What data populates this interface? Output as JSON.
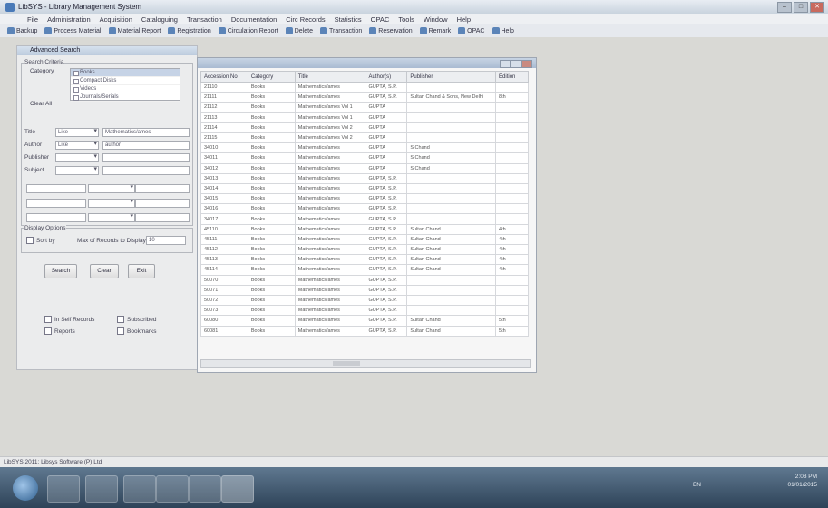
{
  "window": {
    "title": "LibSYS - Library Management System"
  },
  "menu": [
    "File",
    "Administration",
    "Acquisition",
    "Cataloguing",
    "Transaction",
    "Documentation",
    "Circ Records",
    "Statistics",
    "OPAC",
    "Tools",
    "Window",
    "Help"
  ],
  "toolbar": [
    "Backup",
    "Process Material",
    "Material Report",
    "Registration",
    "Circulation Report",
    "Delete",
    "Transaction",
    "Reservation",
    "Remark",
    "OPAC",
    "Help"
  ],
  "search": {
    "panel_title": "Advanced Search",
    "group_label": "Search Criteria",
    "category_label": "Category",
    "categories": [
      "Books",
      "Compact Disks",
      "Videos",
      "Journals/Serials"
    ],
    "clear_all_label": "Clear All",
    "rows": [
      {
        "label": "Title",
        "op": "Like",
        "value": "Mathematics/ames"
      },
      {
        "label": "Author",
        "op": "Like",
        "value": "author"
      },
      {
        "label": "Publisher",
        "op": "",
        "value": ""
      },
      {
        "label": "Subject",
        "op": "",
        "value": ""
      }
    ],
    "display_options_label": "Display Options",
    "sort_label": "Sort by",
    "max_records_label": "Max of Records to Display",
    "max_records_value": "10",
    "search_button": "Search",
    "clear_button": "Clear",
    "exit_button": "Exit",
    "checkboxes": [
      "In Self Records",
      "Subscribed",
      "Reports",
      "Bookmarks"
    ]
  },
  "results": {
    "columns": [
      "Accession No",
      "Category",
      "Title",
      "Author(s)",
      "Publisher",
      "Edition"
    ],
    "rows": [
      [
        "21110",
        "Books",
        "Mathematics/ames",
        "GUPTA, S.P.",
        "",
        ""
      ],
      [
        "21111",
        "Books",
        "Mathematics/ames",
        "GUPTA, S.P.",
        "Sultan Chand & Sons, New Delhi",
        "8th"
      ],
      [
        "21112",
        "Books",
        "Mathematics/ames Vol 1",
        "GUPTA",
        "",
        ""
      ],
      [
        "21113",
        "Books",
        "Mathematics/ames Vol 1",
        "GUPTA",
        "",
        ""
      ],
      [
        "21114",
        "Books",
        "Mathematics/ames Vol 2",
        "GUPTA",
        "",
        ""
      ],
      [
        "21115",
        "Books",
        "Mathematics/ames Vol 2",
        "GUPTA",
        "",
        ""
      ],
      [
        "34010",
        "Books",
        "Mathematics/ames",
        "GUPTA",
        "S.Chand",
        ""
      ],
      [
        "34011",
        "Books",
        "Mathematics/ames",
        "GUPTA",
        "S.Chand",
        ""
      ],
      [
        "34012",
        "Books",
        "Mathematics/ames",
        "GUPTA",
        "S.Chand",
        ""
      ],
      [
        "34013",
        "Books",
        "Mathematics/ames",
        "GUPTA, S.P.",
        "",
        ""
      ],
      [
        "34014",
        "Books",
        "Mathematics/ames",
        "GUPTA, S.P.",
        "",
        ""
      ],
      [
        "34015",
        "Books",
        "Mathematics/ames",
        "GUPTA, S.P.",
        "",
        ""
      ],
      [
        "34016",
        "Books",
        "Mathematics/ames",
        "GUPTA, S.P.",
        "",
        ""
      ],
      [
        "34017",
        "Books",
        "Mathematics/ames",
        "GUPTA, S.P.",
        "",
        ""
      ],
      [
        "45110",
        "Books",
        "Mathematics/ames",
        "GUPTA, S.P.",
        "Sultan Chand",
        "4th"
      ],
      [
        "45111",
        "Books",
        "Mathematics/ames",
        "GUPTA, S.P.",
        "Sultan Chand",
        "4th"
      ],
      [
        "45112",
        "Books",
        "Mathematics/ames",
        "GUPTA, S.P.",
        "Sultan Chand",
        "4th"
      ],
      [
        "45113",
        "Books",
        "Mathematics/ames",
        "GUPTA, S.P.",
        "Sultan Chand",
        "4th"
      ],
      [
        "45114",
        "Books",
        "Mathematics/ames",
        "GUPTA, S.P.",
        "Sultan Chand",
        "4th"
      ],
      [
        "50070",
        "Books",
        "Mathematics/ames",
        "GUPTA, S.P.",
        "",
        ""
      ],
      [
        "50071",
        "Books",
        "Mathematics/ames",
        "GUPTA, S.P.",
        "",
        ""
      ],
      [
        "50072",
        "Books",
        "Mathematics/ames",
        "GUPTA, S.P.",
        "",
        ""
      ],
      [
        "50073",
        "Books",
        "Mathematics/ames",
        "GUPTA, S.P.",
        "",
        ""
      ],
      [
        "60080",
        "Books",
        "Mathematics/ames",
        "GUPTA, S.P.",
        "Sultan Chand",
        "5th"
      ],
      [
        "60081",
        "Books",
        "Mathematics/ames",
        "GUPTA, S.P.",
        "Sultan Chand",
        "5th"
      ]
    ]
  },
  "statusbar": {
    "text": "LibSYS 2011: Libsys Software (P) Ltd"
  },
  "taskbar": {
    "language": "EN",
    "time": "2:03 PM",
    "date": "01/01/2015"
  },
  "colors": {
    "accent": "#4a7ab8",
    "taskbar": "#3a5068"
  }
}
